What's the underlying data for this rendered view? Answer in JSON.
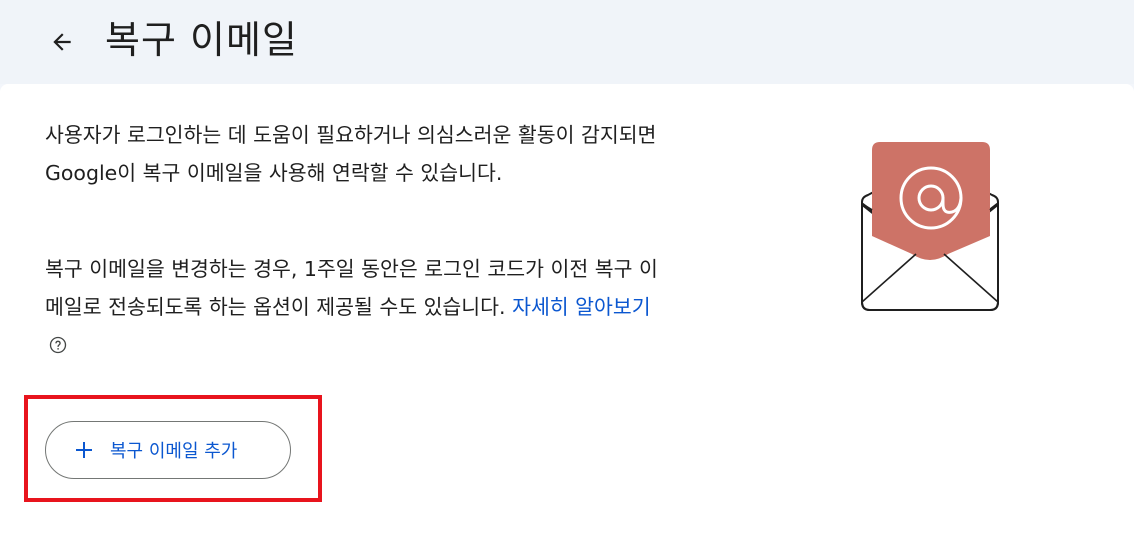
{
  "header": {
    "back_icon": "arrow-back-icon",
    "title": "복구 이메일"
  },
  "main": {
    "description_1": "사용자가 로그인하는 데 도움이 필요하거나 의심스러운 활동이 감지되면 Google이 복구 이메일을 사용해 연락할 수 있습니다.",
    "description_2": "복구 이메일을 변경하는 경우, 1주일 동안은 로그인 코드가 이전 복구 이메일로 전송되도록 하는 옵션이 제공될 수도 있습니다.",
    "learn_more_label": "자세히 알아보기",
    "help_icon": "help-circle-icon",
    "illustration": "envelope-at-icon",
    "add_button": {
      "icon": "plus-icon",
      "label": "복구 이메일 추가"
    }
  },
  "colors": {
    "accent": "#0b57d0",
    "header_bg": "#f0f4f9",
    "envelope_card": "#cd7367",
    "highlight": "#e8141d"
  }
}
